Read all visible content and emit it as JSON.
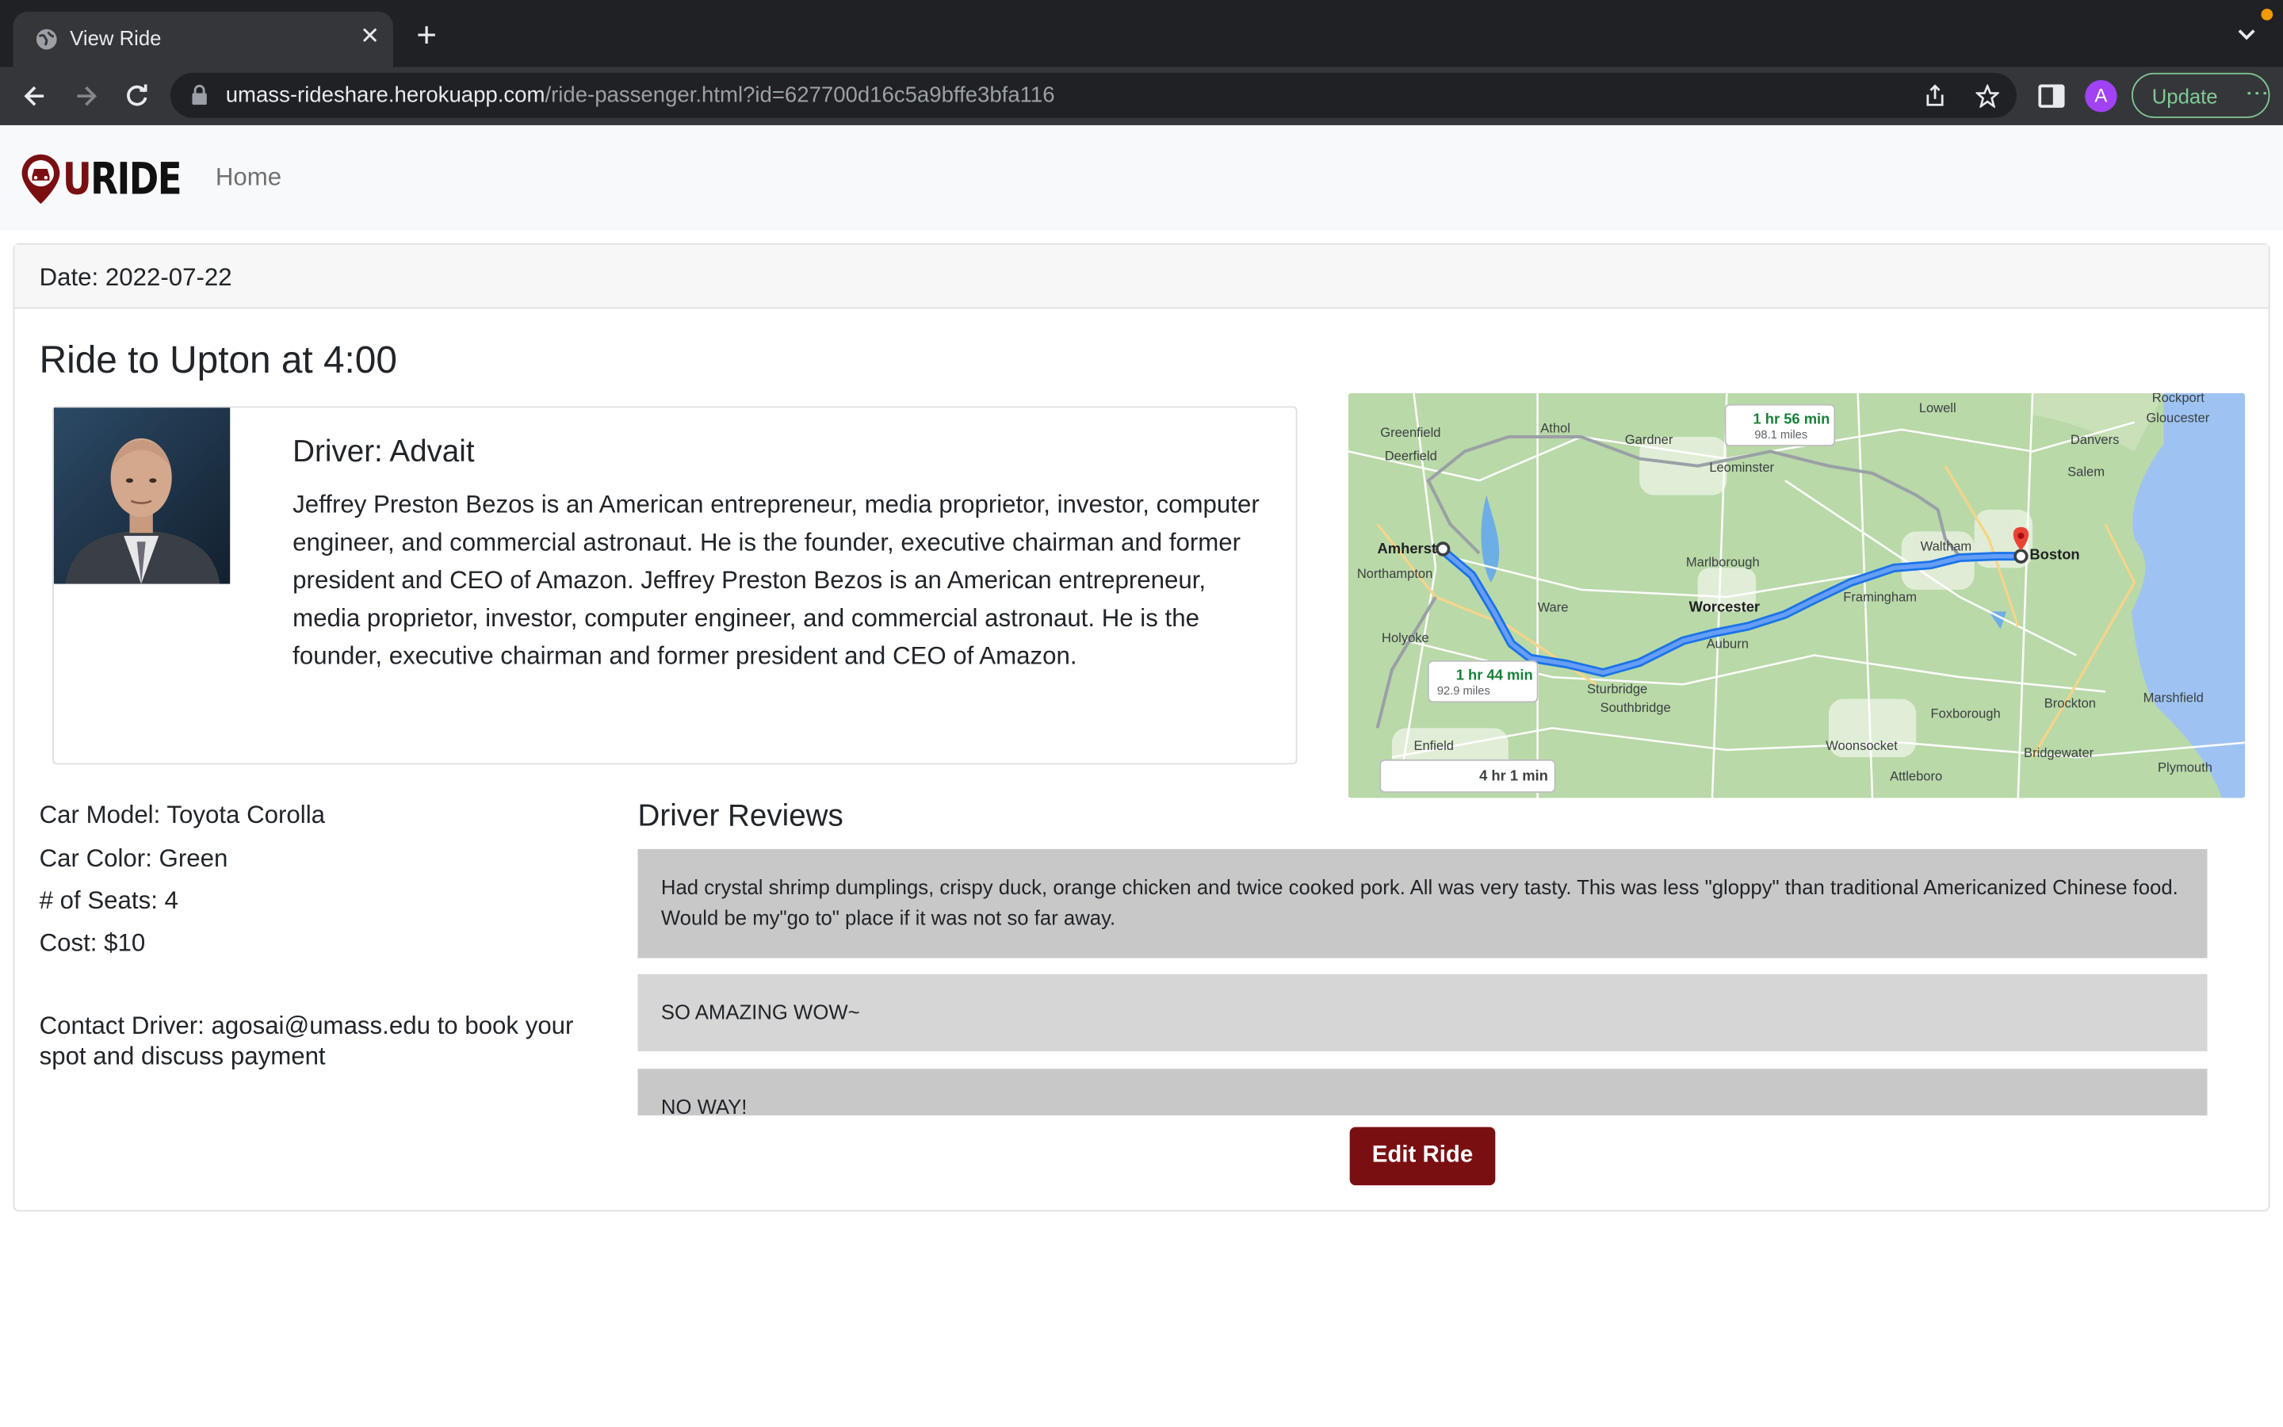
{
  "browser": {
    "tab_title": "View Ride",
    "url_host": "umass-rideshare.herokuapp.com",
    "url_path": "/ride-passenger.html?id=627700d16c5a9bffe3bfa116",
    "profile_initial": "A",
    "update_label": "Update"
  },
  "navbar": {
    "logo_u": "U",
    "logo_rest": "RIDE",
    "home_label": "Home"
  },
  "ride": {
    "date": "Date: 2022-07-22",
    "title": "Ride to Upton at 4:00",
    "driver_name": "Driver: Advait",
    "driver_bio": "Jeffrey Preston Bezos is an American entrepreneur, media proprietor, investor, computer engineer, and commercial astronaut. He is the founder, executive chairman and former president and CEO of Amazon. Jeffrey Preston Bezos is an American entrepreneur, media proprietor, investor, computer engineer, and commercial astronaut. He is the founder, executive chairman and former president and CEO of Amazon.",
    "car_model": "Car Model: Toyota Corolla",
    "car_color": "Car Color: Green",
    "seats": "# of Seats: 4",
    "cost": "Cost: $10",
    "contact": "Contact Driver: agosai@umass.edu to book your spot and discuss payment"
  },
  "map": {
    "towns": [
      "Rockport",
      "Lowell",
      "Gloucester",
      "Greenfield",
      "Athol",
      "Gardner",
      "Danvers",
      "Deerfield",
      "Leominster",
      "Salem",
      "Amherst",
      "Waltham",
      "Boston",
      "Northampton",
      "Marlborough",
      "Worcester",
      "Framingham",
      "Ware",
      "Holyoke",
      "Auburn",
      "Sturbridge",
      "Southbridge",
      "Foxborough",
      "Brockton",
      "Marshfield",
      "Enfield",
      "Woonsocket",
      "Bridgewater",
      "Attleboro",
      "Plymouth"
    ],
    "route_labels": {
      "alt1_time": "1 hr 56 min",
      "alt1_dist": "98.1 miles",
      "main_time": "1 hr 44 min",
      "main_dist": "92.9 miles",
      "transit_time": "4 hr 1 min"
    }
  },
  "reviews": {
    "title": "Driver Reviews",
    "items": [
      "Had crystal shrimp dumplings, crispy duck, orange chicken and twice cooked pork. All was very tasty. This was less \"gloppy\" than traditional Americanized Chinese food. Would be my\"go to\" place if it was not so far away.",
      "SO AMAZING WOW~",
      "NO WAY!"
    ]
  },
  "edit_button": "Edit Ride",
  "colors": {
    "brand": "#7a0f12",
    "review_bg_1": "#c8c8c8",
    "review_bg_2": "#d6d6d6",
    "update_accent": "#81c995"
  }
}
